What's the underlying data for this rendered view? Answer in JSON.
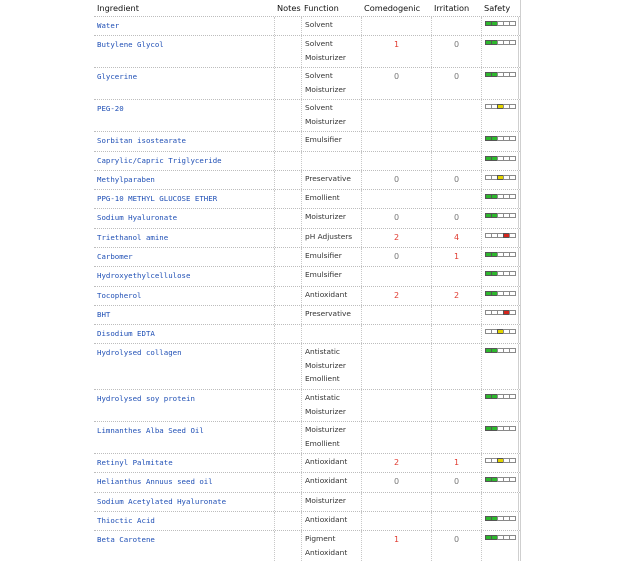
{
  "columns": {
    "ingredient": "Ingredient",
    "notes": "Notes",
    "function": "Function",
    "comedogenic": "Comedogenic",
    "irritation": "Irritation",
    "safety": "Safety"
  },
  "colors": {
    "green": "#2db82d",
    "yellow": "#e2d400",
    "red": "#d4261e",
    "link": "#1f4fb5"
  },
  "rows": [
    {
      "name": "Water",
      "functions": [
        "Solvent"
      ],
      "comedogenic": "",
      "irritation": "",
      "safety": "green",
      "h": 18
    },
    {
      "name": "Butylene Glycol",
      "functions": [
        "Solvent",
        "Moisturizer"
      ],
      "comedogenic": "1",
      "irritation": "0",
      "safety": "green",
      "h": 31
    },
    {
      "name": "Glycerine",
      "functions": [
        "Solvent",
        "Moisturizer"
      ],
      "comedogenic": "0",
      "irritation": "0",
      "safety": "green",
      "h": 31
    },
    {
      "name": "PEG-20",
      "functions": [
        "Solvent",
        "Moisturizer"
      ],
      "comedogenic": "",
      "irritation": "",
      "safety": "yellow",
      "h": 31
    },
    {
      "name": "Sorbitan isostearate",
      "functions": [
        "Emulsifier"
      ],
      "comedogenic": "",
      "irritation": "",
      "safety": "green",
      "h": 19
    },
    {
      "name": "Caprylic/Capric Triglyceride",
      "functions": [
        ""
      ],
      "comedogenic": "",
      "irritation": "",
      "safety": "green",
      "h": 18
    },
    {
      "name": "Methylparaben",
      "functions": [
        "Preservative"
      ],
      "comedogenic": "0",
      "irritation": "0",
      "safety": "yellow",
      "h": 18
    },
    {
      "name": "PPG-10 METHYL GLUCOSE ETHER",
      "functions": [
        "Emollient"
      ],
      "comedogenic": "",
      "irritation": "",
      "safety": "green",
      "h": 18
    },
    {
      "name": "Sodium Hyaluronate",
      "functions": [
        "Moisturizer"
      ],
      "comedogenic": "0",
      "irritation": "0",
      "safety": "green",
      "h": 19
    },
    {
      "name": "Triethanol amine",
      "functions": [
        "pH Adjusters"
      ],
      "comedogenic": "2",
      "irritation": "4",
      "safety": "red",
      "h": 18
    },
    {
      "name": "Carbomer",
      "functions": [
        "Emulsifier"
      ],
      "comedogenic": "0",
      "irritation": "1",
      "safety": "green",
      "h": 18
    },
    {
      "name": "Hydroxyethylcellulose",
      "functions": [
        "Emulsifier"
      ],
      "comedogenic": "",
      "irritation": "",
      "safety": "green",
      "h": 19
    },
    {
      "name": "Tocopherol",
      "functions": [
        "Antioxidant"
      ],
      "comedogenic": "2",
      "irritation": "2",
      "safety": "green",
      "h": 18
    },
    {
      "name": "BHT",
      "functions": [
        "Preservative"
      ],
      "comedogenic": "",
      "irritation": "",
      "safety": "red",
      "h": 18
    },
    {
      "name": "Disodium EDTA",
      "functions": [
        ""
      ],
      "comedogenic": "",
      "irritation": "",
      "safety": "yellow",
      "h": 18
    },
    {
      "name": "Hydrolysed collagen",
      "functions": [
        "Antistatic",
        "Moisturizer",
        "Emollient"
      ],
      "comedogenic": "",
      "irritation": "",
      "safety": "green",
      "h": 45
    },
    {
      "name": "Hydrolysed soy protein",
      "functions": [
        "Antistatic",
        "Moisturizer"
      ],
      "comedogenic": "",
      "irritation": "",
      "safety": "green",
      "h": 31
    },
    {
      "name": "Limnanthes Alba Seed Oil",
      "functions": [
        "Moisturizer",
        "Emollient"
      ],
      "comedogenic": "",
      "irritation": "",
      "safety": "green",
      "h": 31
    },
    {
      "name": "Retinyl Palmitate",
      "functions": [
        "Antioxidant"
      ],
      "comedogenic": "2",
      "irritation": "1",
      "safety": "yellow",
      "h": 18
    },
    {
      "name": "Helianthus Annuus seed oil",
      "functions": [
        "Antioxidant"
      ],
      "comedogenic": "0",
      "irritation": "0",
      "safety": "green",
      "h": 19
    },
    {
      "name": "Sodium Acetylated Hyaluronate",
      "functions": [
        "Moisturizer"
      ],
      "comedogenic": "",
      "irritation": "",
      "safety": "",
      "h": 18
    },
    {
      "name": "Thioctic Acid",
      "functions": [
        "Antioxidant"
      ],
      "comedogenic": "",
      "irritation": "",
      "safety": "green",
      "h": 18
    },
    {
      "name": "Beta Carotene",
      "functions": [
        "Pigment",
        "Antioxidant"
      ],
      "comedogenic": "1",
      "irritation": "0",
      "safety": "green",
      "h": 30
    }
  ]
}
